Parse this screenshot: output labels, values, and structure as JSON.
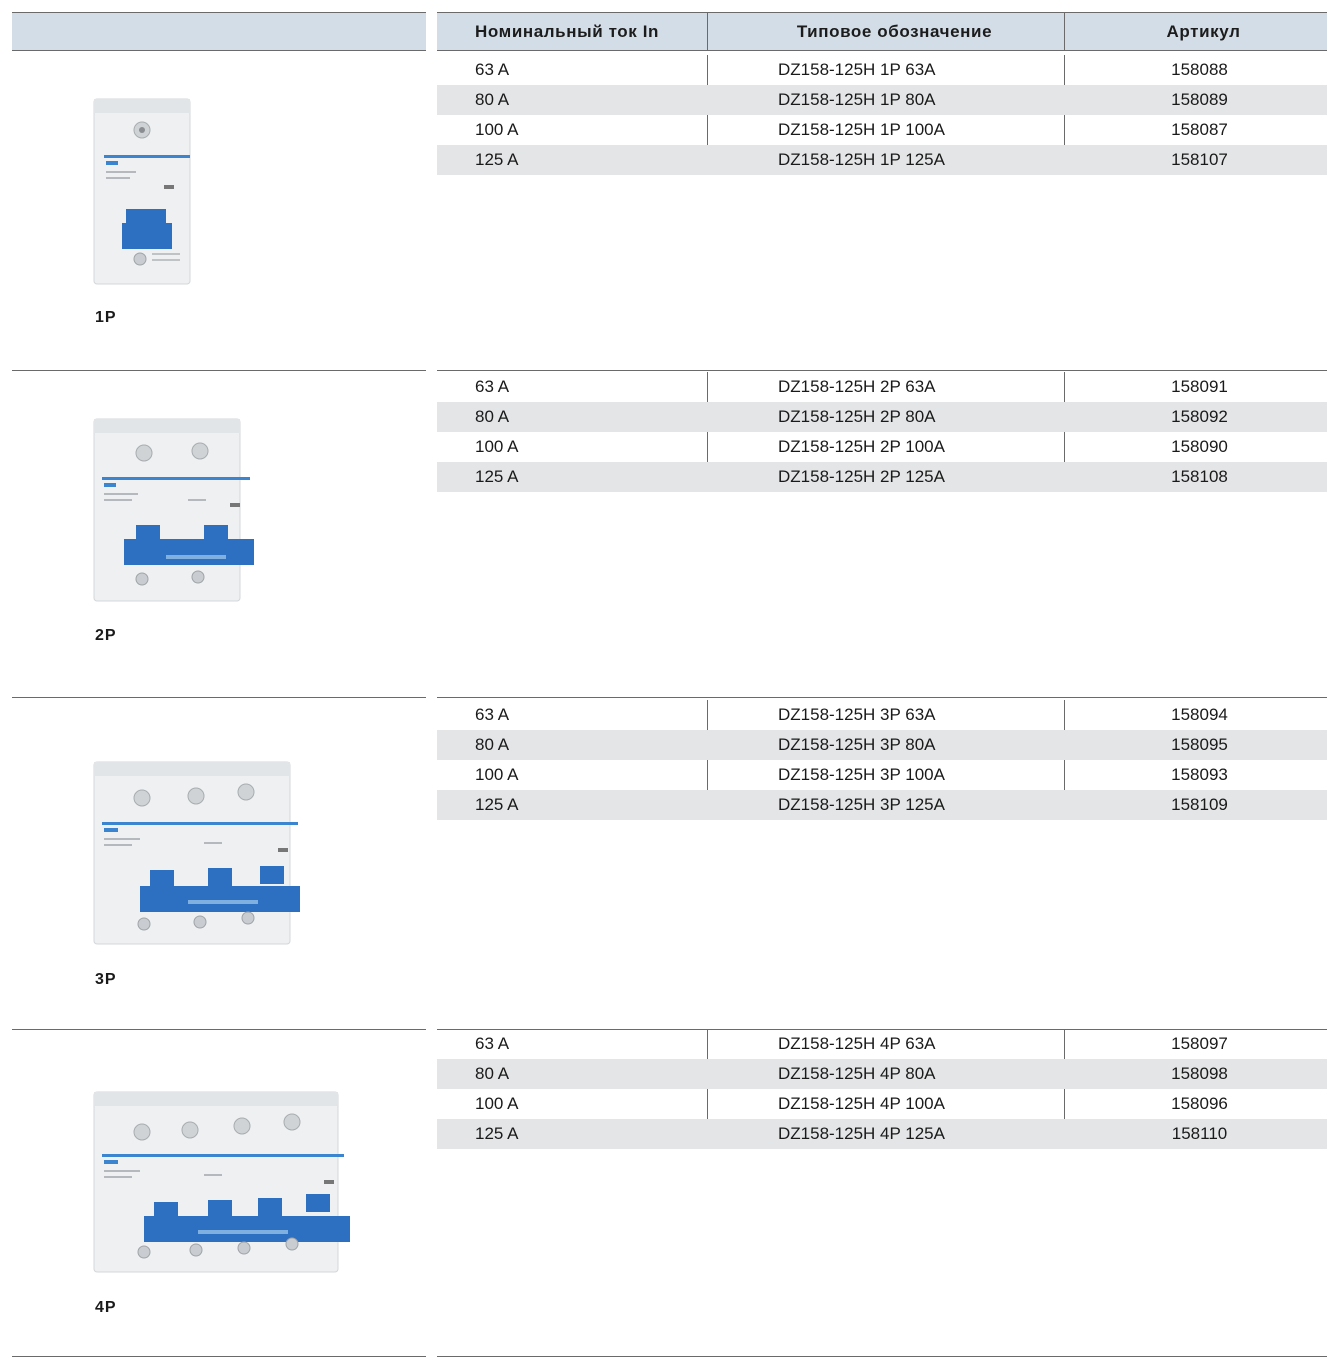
{
  "header": {
    "col_current": "Номинальный ток  In",
    "col_type": "Типовое обозначение",
    "col_article": "Артикул"
  },
  "sections": [
    {
      "pole": "1P",
      "rows": [
        {
          "current": "63 A",
          "type": "DZ158-125H 1P 63A",
          "article": "158088"
        },
        {
          "current": "80 A",
          "type": "DZ158-125H 1P 80A",
          "article": "158089"
        },
        {
          "current": "100 A",
          "type": "DZ158-125H 1P 100A",
          "article": "158087"
        },
        {
          "current": "125 A",
          "type": "DZ158-125H 1P 125A",
          "article": "158107"
        }
      ]
    },
    {
      "pole": "2P",
      "rows": [
        {
          "current": "63 A",
          "type": "DZ158-125H 2P 63A",
          "article": "158091"
        },
        {
          "current": "80 A",
          "type": "DZ158-125H 2P 80A",
          "article": "158092"
        },
        {
          "current": "100 A",
          "type": "DZ158-125H 2P 100A",
          "article": "158090"
        },
        {
          "current": "125 A",
          "type": "DZ158-125H 2P 125A",
          "article": "158108"
        }
      ]
    },
    {
      "pole": "3P",
      "rows": [
        {
          "current": "63 A",
          "type": "DZ158-125H 3P 63A",
          "article": "158094"
        },
        {
          "current": "80 A",
          "type": "DZ158-125H 3P 80A",
          "article": "158095"
        },
        {
          "current": "100 A",
          "type": "DZ158-125H 3P 100A",
          "article": "158093"
        },
        {
          "current": "125 A",
          "type": "DZ158-125H 3P 125A",
          "article": "158109"
        }
      ]
    },
    {
      "pole": "4P",
      "rows": [
        {
          "current": "63 A",
          "type": "DZ158-125H 4P 63A",
          "article": "158097"
        },
        {
          "current": "80 A",
          "type": "DZ158-125H 4P 80A",
          "article": "158098"
        },
        {
          "current": "100 A",
          "type": "DZ158-125H 4P 100A",
          "article": "158096"
        },
        {
          "current": "125 A",
          "type": "DZ158-125H 4P 125A",
          "article": "158110"
        }
      ]
    }
  ],
  "colors": {
    "header_bg": "#d3dde7",
    "row_shade": "#e4e5e7",
    "breaker_body": "#f2f3f4",
    "breaker_handle": "#2d6fc0",
    "brand_blue": "#3a84d0"
  },
  "icons": [
    "circuit-breaker-1p-image",
    "circuit-breaker-2p-image",
    "circuit-breaker-3p-image",
    "circuit-breaker-4p-image"
  ]
}
